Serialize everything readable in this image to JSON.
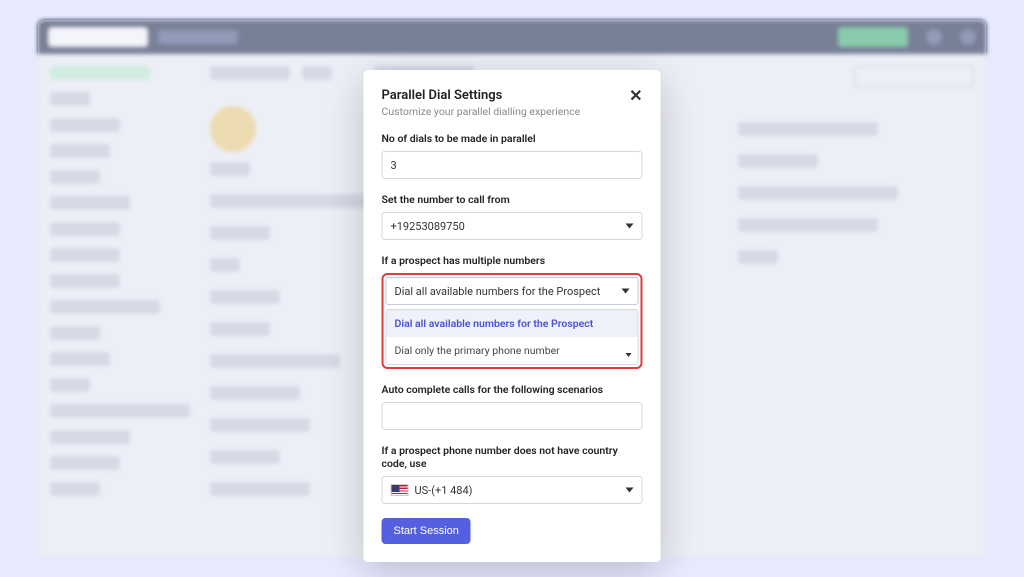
{
  "modal": {
    "title": "Parallel Dial Settings",
    "subtitle": "Customize your parallel dialling experience",
    "close_symbol": "✕",
    "fields": {
      "dials": {
        "label": "No of dials to be made in parallel",
        "value": "3"
      },
      "call_from": {
        "label": "Set the number to call from",
        "value": "+19253089750"
      },
      "multiple_numbers": {
        "label": "If a prospect has multiple numbers",
        "value": "Dial all available numbers for the Prospect",
        "options": [
          "Dial all available numbers for the Prospect",
          "Dial only the primary phone number"
        ]
      },
      "auto_complete": {
        "label": "Auto complete calls for the following scenarios",
        "value": ""
      },
      "country_code": {
        "label": "If a prospect phone number does not have country code, use",
        "value": "US-(+1 484)"
      }
    },
    "start_button": "Start Session"
  }
}
